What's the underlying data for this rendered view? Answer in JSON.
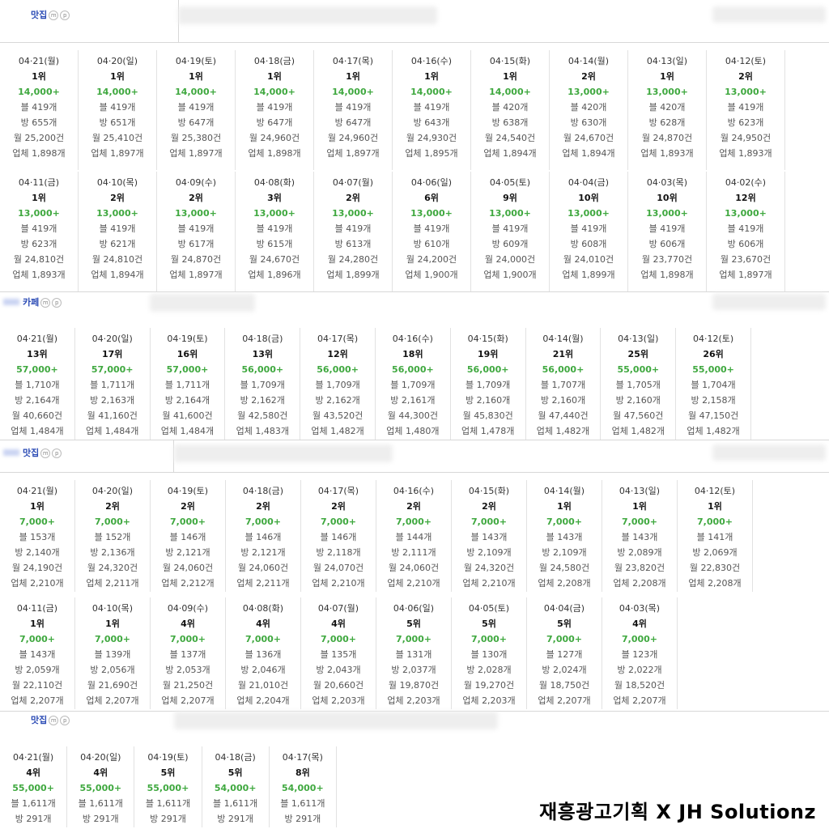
{
  "brand": "재흥광고기획 X JH Solutionz",
  "stat_labels": {
    "blog": "블",
    "room": "방",
    "month": "월",
    "biz": "업체"
  },
  "sections": [
    {
      "title": "맛집",
      "badges": [
        "m",
        "p"
      ],
      "rows": [
        [
          {
            "date": "04·21(월)",
            "rank": "1위",
            "count": "14,000+",
            "blog": "419개",
            "room": "655개",
            "month": "25,200건",
            "biz": "1,898개"
          },
          {
            "date": "04·20(일)",
            "rank": "1위",
            "count": "14,000+",
            "blog": "419개",
            "room": "651개",
            "month": "25,410건",
            "biz": "1,897개"
          },
          {
            "date": "04·19(토)",
            "rank": "1위",
            "count": "14,000+",
            "blog": "419개",
            "room": "647개",
            "month": "25,380건",
            "biz": "1,897개"
          },
          {
            "date": "04·18(금)",
            "rank": "1위",
            "count": "14,000+",
            "blog": "419개",
            "room": "647개",
            "month": "24,960건",
            "biz": "1,898개"
          },
          {
            "date": "04·17(목)",
            "rank": "1위",
            "count": "14,000+",
            "blog": "419개",
            "room": "647개",
            "month": "24,960건",
            "biz": "1,897개"
          },
          {
            "date": "04·16(수)",
            "rank": "1위",
            "count": "14,000+",
            "blog": "419개",
            "room": "643개",
            "month": "24,930건",
            "biz": "1,895개"
          },
          {
            "date": "04·15(화)",
            "rank": "1위",
            "count": "14,000+",
            "blog": "420개",
            "room": "638개",
            "month": "24,540건",
            "biz": "1,894개"
          },
          {
            "date": "04·14(월)",
            "rank": "2위",
            "count": "13,000+",
            "blog": "420개",
            "room": "630개",
            "month": "24,670건",
            "biz": "1,894개"
          },
          {
            "date": "04·13(일)",
            "rank": "1위",
            "count": "13,000+",
            "blog": "420개",
            "room": "628개",
            "month": "24,870건",
            "biz": "1,893개"
          },
          {
            "date": "04·12(토)",
            "rank": "2위",
            "count": "13,000+",
            "blog": "419개",
            "room": "623개",
            "month": "24,950건",
            "biz": "1,893개"
          }
        ],
        [
          {
            "date": "04·11(금)",
            "rank": "1위",
            "count": "13,000+",
            "blog": "419개",
            "room": "623개",
            "month": "24,810건",
            "biz": "1,893개"
          },
          {
            "date": "04·10(목)",
            "rank": "2위",
            "count": "13,000+",
            "blog": "419개",
            "room": "621개",
            "month": "24,810건",
            "biz": "1,894개"
          },
          {
            "date": "04·09(수)",
            "rank": "2위",
            "count": "13,000+",
            "blog": "419개",
            "room": "617개",
            "month": "24,870건",
            "biz": "1,897개"
          },
          {
            "date": "04·08(화)",
            "rank": "3위",
            "count": "13,000+",
            "blog": "419개",
            "room": "615개",
            "month": "24,670건",
            "biz": "1,896개"
          },
          {
            "date": "04·07(월)",
            "rank": "2위",
            "count": "13,000+",
            "blog": "419개",
            "room": "613개",
            "month": "24,280건",
            "biz": "1,899개"
          },
          {
            "date": "04·06(일)",
            "rank": "6위",
            "count": "13,000+",
            "blog": "419개",
            "room": "610개",
            "month": "24,200건",
            "biz": "1,900개"
          },
          {
            "date": "04·05(토)",
            "rank": "9위",
            "count": "13,000+",
            "blog": "419개",
            "room": "609개",
            "month": "24,000건",
            "biz": "1,900개"
          },
          {
            "date": "04·04(금)",
            "rank": "10위",
            "count": "13,000+",
            "blog": "419개",
            "room": "608개",
            "month": "24,010건",
            "biz": "1,899개"
          },
          {
            "date": "04·03(목)",
            "rank": "10위",
            "count": "13,000+",
            "blog": "419개",
            "room": "606개",
            "month": "23,770건",
            "biz": "1,898개"
          },
          {
            "date": "04·02(수)",
            "rank": "12위",
            "count": "13,000+",
            "blog": "419개",
            "room": "606개",
            "month": "23,670건",
            "biz": "1,897개"
          }
        ]
      ]
    },
    {
      "title": "카페",
      "badges": [
        "m",
        "p"
      ],
      "rows": [
        [
          {
            "date": "04·21(월)",
            "rank": "13위",
            "count": "57,000+",
            "blog": "1,710개",
            "room": "2,164개",
            "month": "40,660건",
            "biz": "1,484개"
          },
          {
            "date": "04·20(일)",
            "rank": "17위",
            "count": "57,000+",
            "blog": "1,711개",
            "room": "2,163개",
            "month": "41,160건",
            "biz": "1,484개"
          },
          {
            "date": "04·19(토)",
            "rank": "16위",
            "count": "57,000+",
            "blog": "1,711개",
            "room": "2,164개",
            "month": "41,600건",
            "biz": "1,484개"
          },
          {
            "date": "04·18(금)",
            "rank": "13위",
            "count": "56,000+",
            "blog": "1,709개",
            "room": "2,162개",
            "month": "42,580건",
            "biz": "1,483개"
          },
          {
            "date": "04·17(목)",
            "rank": "12위",
            "count": "56,000+",
            "blog": "1,709개",
            "room": "2,162개",
            "month": "43,520건",
            "biz": "1,482개"
          },
          {
            "date": "04·16(수)",
            "rank": "18위",
            "count": "56,000+",
            "blog": "1,709개",
            "room": "2,161개",
            "month": "44,300건",
            "biz": "1,480개"
          },
          {
            "date": "04·15(화)",
            "rank": "19위",
            "count": "56,000+",
            "blog": "1,709개",
            "room": "2,160개",
            "month": "45,830건",
            "biz": "1,478개"
          },
          {
            "date": "04·14(월)",
            "rank": "21위",
            "count": "56,000+",
            "blog": "1,707개",
            "room": "2,160개",
            "month": "47,440건",
            "biz": "1,482개"
          },
          {
            "date": "04·13(일)",
            "rank": "25위",
            "count": "55,000+",
            "blog": "1,705개",
            "room": "2,160개",
            "month": "47,560건",
            "biz": "1,482개"
          },
          {
            "date": "04·12(토)",
            "rank": "26위",
            "count": "55,000+",
            "blog": "1,704개",
            "room": "2,158개",
            "month": "47,150건",
            "biz": "1,482개"
          }
        ]
      ]
    },
    {
      "title": "맛집",
      "badges": [
        "m",
        "p"
      ],
      "rows": [
        [
          {
            "date": "04·21(월)",
            "rank": "1위",
            "count": "7,000+",
            "blog": "153개",
            "room": "2,140개",
            "month": "24,190건",
            "biz": "2,210개"
          },
          {
            "date": "04·20(일)",
            "rank": "2위",
            "count": "7,000+",
            "blog": "152개",
            "room": "2,136개",
            "month": "24,320건",
            "biz": "2,211개"
          },
          {
            "date": "04·19(토)",
            "rank": "2위",
            "count": "7,000+",
            "blog": "146개",
            "room": "2,121개",
            "month": "24,060건",
            "biz": "2,212개"
          },
          {
            "date": "04·18(금)",
            "rank": "2위",
            "count": "7,000+",
            "blog": "146개",
            "room": "2,121개",
            "month": "24,060건",
            "biz": "2,211개"
          },
          {
            "date": "04·17(목)",
            "rank": "2위",
            "count": "7,000+",
            "blog": "146개",
            "room": "2,118개",
            "month": "24,070건",
            "biz": "2,210개"
          },
          {
            "date": "04·16(수)",
            "rank": "2위",
            "count": "7,000+",
            "blog": "144개",
            "room": "2,111개",
            "month": "24,060건",
            "biz": "2,210개"
          },
          {
            "date": "04·15(화)",
            "rank": "2위",
            "count": "7,000+",
            "blog": "143개",
            "room": "2,109개",
            "month": "24,320건",
            "biz": "2,210개"
          },
          {
            "date": "04·14(월)",
            "rank": "1위",
            "count": "7,000+",
            "blog": "143개",
            "room": "2,109개",
            "month": "24,580건",
            "biz": "2,208개"
          },
          {
            "date": "04·13(일)",
            "rank": "1위",
            "count": "7,000+",
            "blog": "143개",
            "room": "2,089개",
            "month": "23,820건",
            "biz": "2,208개"
          },
          {
            "date": "04·12(토)",
            "rank": "1위",
            "count": "7,000+",
            "blog": "141개",
            "room": "2,069개",
            "month": "22,830건",
            "biz": "2,208개"
          }
        ],
        [
          {
            "date": "04·11(금)",
            "rank": "1위",
            "count": "7,000+",
            "blog": "143개",
            "room": "2,059개",
            "month": "22,110건",
            "biz": "2,207개"
          },
          {
            "date": "04·10(목)",
            "rank": "1위",
            "count": "7,000+",
            "blog": "139개",
            "room": "2,056개",
            "month": "21,690건",
            "biz": "2,207개"
          },
          {
            "date": "04·09(수)",
            "rank": "4위",
            "count": "7,000+",
            "blog": "137개",
            "room": "2,053개",
            "month": "21,250건",
            "biz": "2,207개"
          },
          {
            "date": "04·08(화)",
            "rank": "4위",
            "count": "7,000+",
            "blog": "136개",
            "room": "2,046개",
            "month": "21,010건",
            "biz": "2,204개"
          },
          {
            "date": "04·07(월)",
            "rank": "4위",
            "count": "7,000+",
            "blog": "135개",
            "room": "2,043개",
            "month": "20,660건",
            "biz": "2,203개"
          },
          {
            "date": "04·06(일)",
            "rank": "5위",
            "count": "7,000+",
            "blog": "131개",
            "room": "2,037개",
            "month": "19,870건",
            "biz": "2,203개"
          },
          {
            "date": "04·05(토)",
            "rank": "5위",
            "count": "7,000+",
            "blog": "130개",
            "room": "2,028개",
            "month": "19,270건",
            "biz": "2,203개"
          },
          {
            "date": "04·04(금)",
            "rank": "5위",
            "count": "7,000+",
            "blog": "127개",
            "room": "2,024개",
            "month": "18,750건",
            "biz": "2,207개"
          },
          {
            "date": "04·03(목)",
            "rank": "4위",
            "count": "7,000+",
            "blog": "123개",
            "room": "2,022개",
            "month": "18,520건",
            "biz": "2,207개"
          }
        ]
      ]
    },
    {
      "title": "맛집",
      "badges": [
        "m",
        "p"
      ],
      "rows": [
        [
          {
            "date": "04·21(월)",
            "rank": "4위",
            "count": "55,000+",
            "blog": "1,611개",
            "room": "291개"
          },
          {
            "date": "04·20(일)",
            "rank": "4위",
            "count": "55,000+",
            "blog": "1,611개",
            "room": "291개"
          },
          {
            "date": "04·19(토)",
            "rank": "5위",
            "count": "55,000+",
            "blog": "1,611개",
            "room": "291개"
          },
          {
            "date": "04·18(금)",
            "rank": "5위",
            "count": "54,000+",
            "blog": "1,611개",
            "room": "291개"
          },
          {
            "date": "04·17(목)",
            "rank": "8위",
            "count": "54,000+",
            "blog": "1,611개",
            "room": "291개"
          }
        ]
      ]
    }
  ]
}
